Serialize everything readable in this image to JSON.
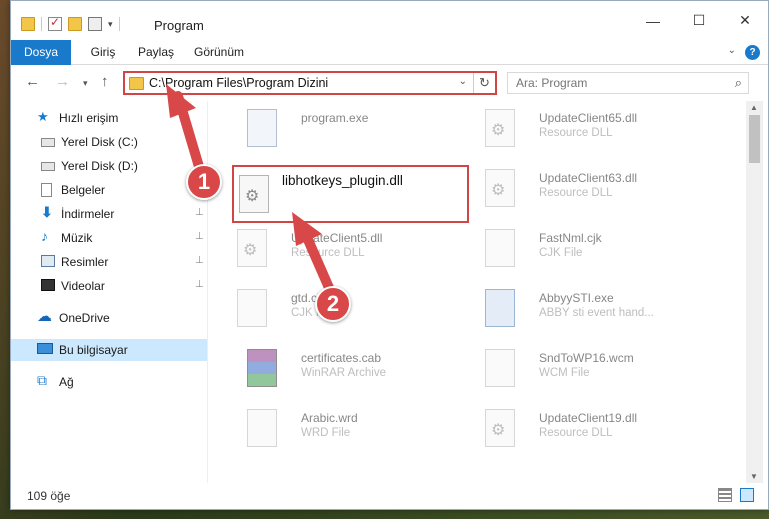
{
  "window": {
    "title": "Program",
    "buttons": {
      "minimize": "—",
      "maximize": "☐",
      "close": "✕"
    }
  },
  "ribbon": {
    "tabs": [
      "Dosya",
      "Giriş",
      "Paylaş",
      "Görünüm"
    ],
    "toggle": "⌄",
    "help": "?"
  },
  "nav": {
    "back": "←",
    "forward": "→",
    "recent": "▾",
    "up": "↑",
    "address": "C:\\Program Files\\Program Dizini",
    "address_caret": "⌄",
    "refresh": "↻",
    "search_placeholder": "Ara: Program",
    "search_icon": "⌕"
  },
  "sidebar": {
    "items": [
      {
        "label": "Hızlı erişim",
        "icon": "star-icon",
        "pinned": false
      },
      {
        "label": "Yerel Disk (C:)",
        "icon": "disk-icon",
        "pinned": false
      },
      {
        "label": "Yerel Disk (D:)",
        "icon": "disk-icon",
        "pinned": false
      },
      {
        "label": "Belgeler",
        "icon": "document-icon",
        "pinned": false
      },
      {
        "label": "İndirmeler",
        "icon": "download-icon",
        "pinned": true
      },
      {
        "label": "Müzik",
        "icon": "music-icon",
        "pinned": true
      },
      {
        "label": "Resimler",
        "icon": "pictures-icon",
        "pinned": true
      },
      {
        "label": "Videolar",
        "icon": "video-icon",
        "pinned": true
      },
      {
        "label": "OneDrive",
        "icon": "cloud-icon",
        "pinned": false
      },
      {
        "label": "Bu bilgisayar",
        "icon": "computer-icon",
        "pinned": false
      },
      {
        "label": "Ağ",
        "icon": "network-icon",
        "pinned": false
      }
    ],
    "pin_glyph": "📌"
  },
  "files": {
    "left": [
      {
        "name": "program.exe",
        "type": ""
      },
      {
        "name": "UpdateClient5.dll",
        "type": "Resource DLL"
      },
      {
        "name": "gtd.cjk",
        "type": "CJK File"
      },
      {
        "name": "certificates.cab",
        "type": "WinRAR Archive"
      },
      {
        "name": "Arabic.wrd",
        "type": "WRD File"
      }
    ],
    "right": [
      {
        "name": "UpdateClient65.dll",
        "type": "Resource DLL"
      },
      {
        "name": "UpdateClient63.dll",
        "type": "Resource DLL"
      },
      {
        "name": "FastNml.cjk",
        "type": "CJK File"
      },
      {
        "name": "AbbyySTI.exe",
        "type": "ABBY sti event hand..."
      },
      {
        "name": "SndToWP16.wcm",
        "type": "WCM File"
      },
      {
        "name": "UpdateClient19.dll",
        "type": "Resource DLL"
      }
    ],
    "highlighted": {
      "name": "libhotkeys_plugin.dll"
    }
  },
  "status": {
    "count": "109 öğe"
  },
  "callouts": {
    "one": "1",
    "two": "2"
  },
  "colors": {
    "accent": "#1979ca",
    "highlight": "#d24545",
    "selected": "#cce8ff"
  }
}
